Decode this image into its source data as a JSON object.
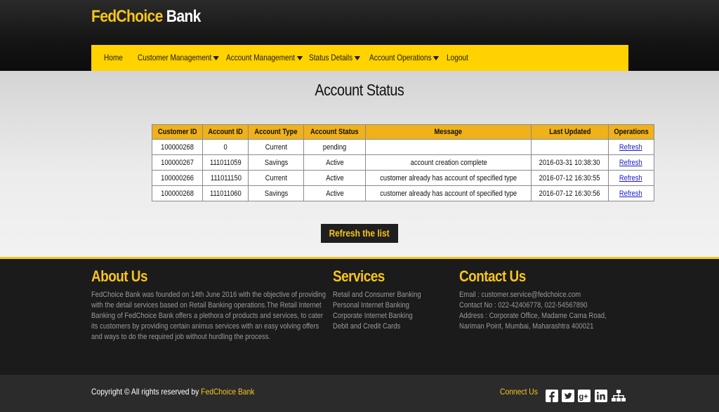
{
  "brand": {
    "name_part1": "FedChoice",
    "name_part2": "Bank"
  },
  "nav": {
    "items": [
      {
        "label": "Home",
        "dropdown": false
      },
      {
        "label": "Customer Management",
        "dropdown": true
      },
      {
        "label": "Account Management",
        "dropdown": true
      },
      {
        "label": "Status Details",
        "dropdown": true
      },
      {
        "label": "Account Operations",
        "dropdown": true
      },
      {
        "label": "Logout",
        "dropdown": false
      }
    ]
  },
  "page": {
    "title": "Account Status"
  },
  "table": {
    "headers": [
      "Customer ID",
      "Account ID",
      "Account Type",
      "Account Status",
      "Message",
      "Last Updated",
      "Operations"
    ],
    "rows": [
      [
        "100000268",
        "0",
        "Current",
        "pending",
        "",
        "",
        "Refresh"
      ],
      [
        "100000267",
        "111011059",
        "Savings",
        "Active",
        "account creation complete",
        "2016-03-31 10:38:30",
        "Refresh"
      ],
      [
        "100000266",
        "111011150",
        "Current",
        "Active",
        "customer already has account of specified type",
        "2016-07-12 16:30:55",
        "Refresh"
      ],
      [
        "100000268",
        "111011060",
        "Savings",
        "Active",
        "customer already has account of specified type",
        "2016-07-12 16:30:56",
        "Refresh"
      ]
    ]
  },
  "refresh_button": {
    "label": "Refresh the list"
  },
  "footer": {
    "about": {
      "title": "About Us",
      "lines": [
        "FedChoice Bank was founded on 14th June 2016 with the objective of providing",
        "with the detail services based on Retail Banking operations.The Retail Internet",
        "Banking of FedChoice Bank offers a plethora of products and services, to cater",
        "its customers by providing certain animus services with an easy volving offers",
        "and ways to do the required job without hurdling the process."
      ]
    },
    "services": {
      "title": "Services",
      "items": [
        "Retail and Consumer Banking",
        "Personal Internet Banking",
        "Corporate Internet Banking",
        "Debit and Credit Cards"
      ]
    },
    "contact": {
      "title": "Contact Us",
      "lines": [
        "Email : customer.service@fedchoice.com",
        "Contact No : 022-42406778, 022-54567890",
        "Address : Corporate Office, Madame Cama Road,",
        "Nariman Point, Mumbai, Maharashtra 400021"
      ]
    },
    "copyright_prefix": "Copyright © All rights reserved by",
    "copyright_brand": "FedChoice Bank",
    "connect_label": "Connect Us",
    "social_icons": [
      "facebook-icon",
      "twitter-icon",
      "google-plus-icon",
      "linkedin-icon",
      "sitemap-icon"
    ]
  },
  "colors": {
    "accent": "#f7c51b",
    "nav_bg": "#ffd200",
    "table_header": "#f0b11a",
    "dark": "#1b1b1b"
  }
}
